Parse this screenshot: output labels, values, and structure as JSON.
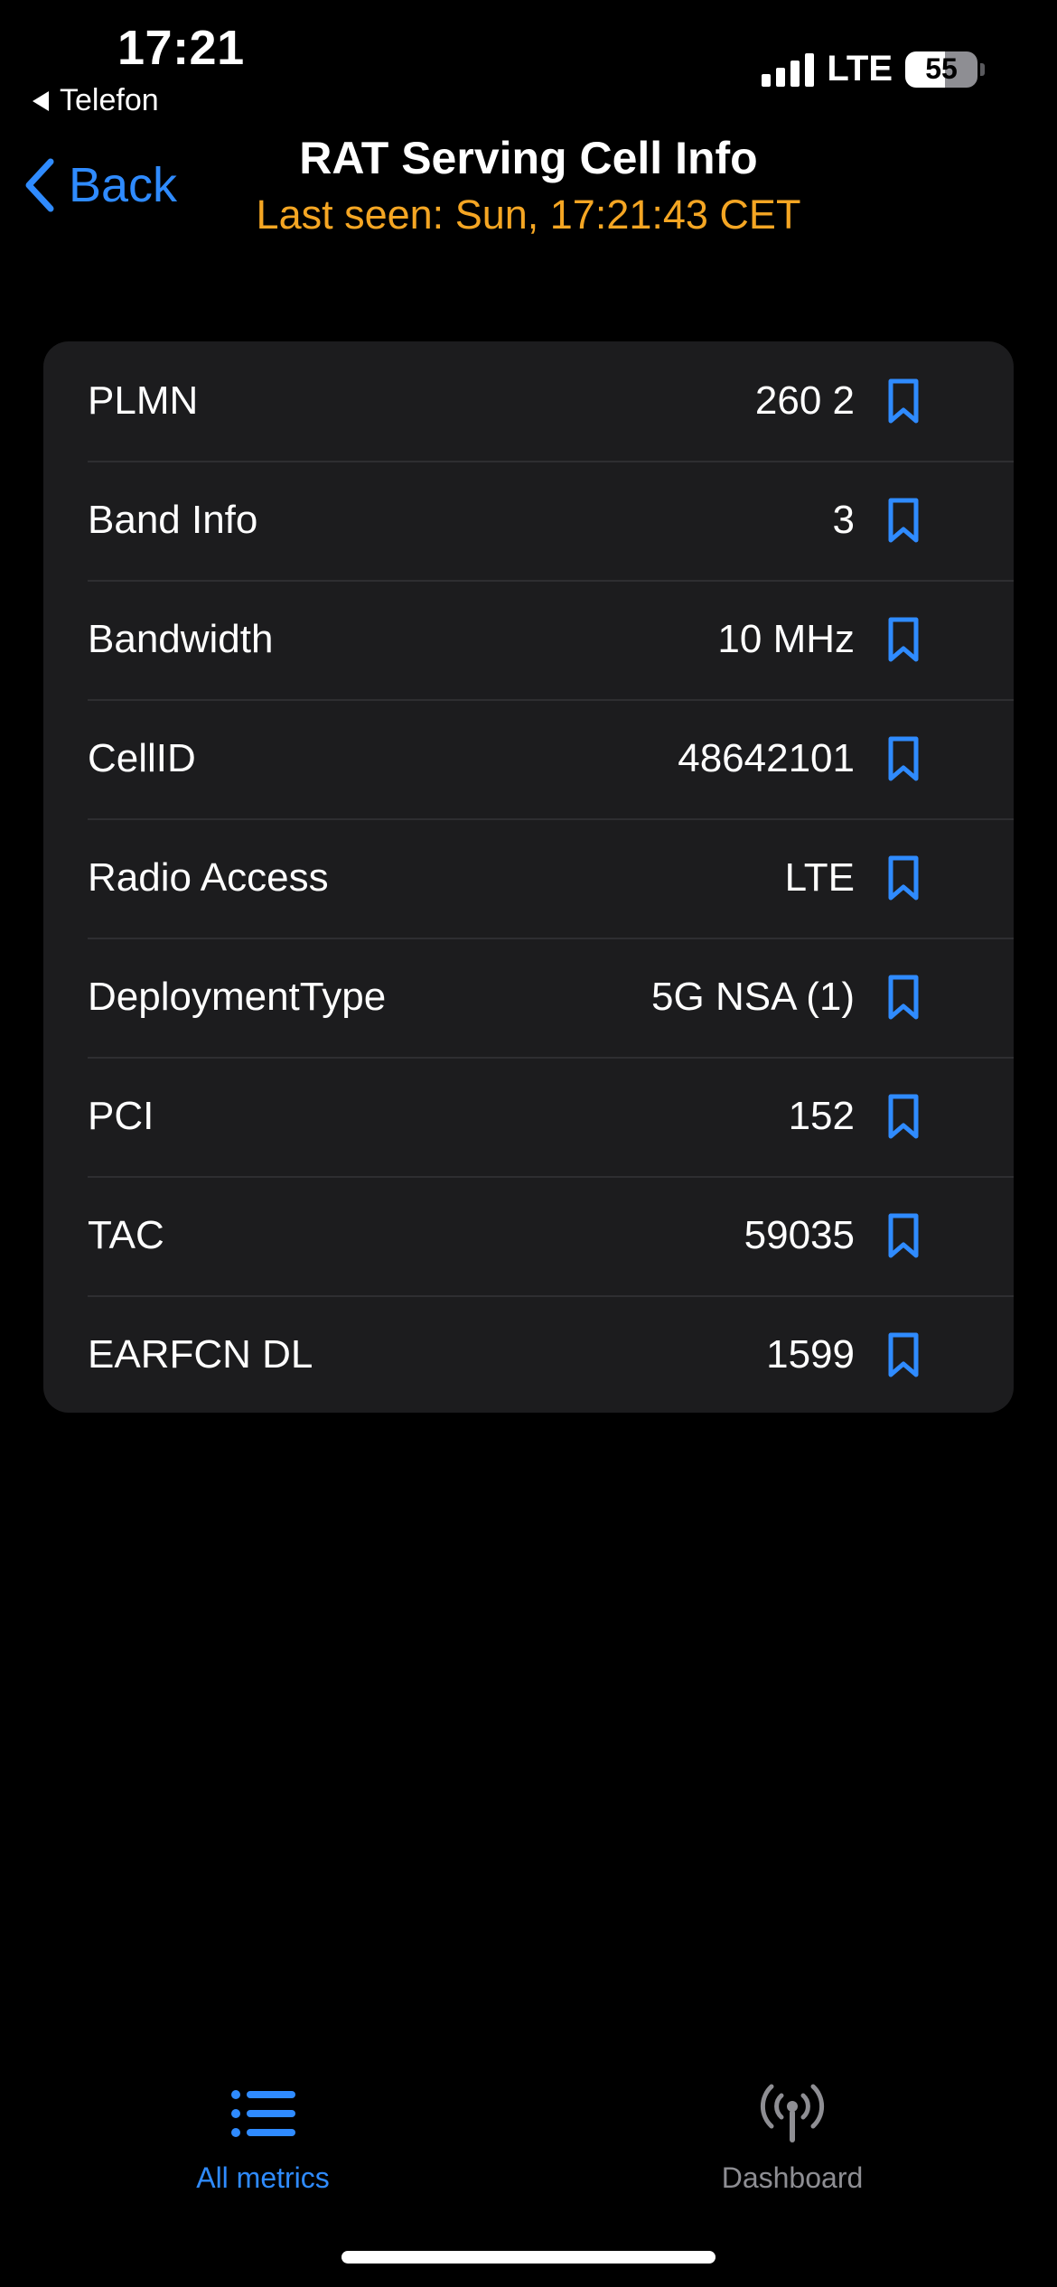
{
  "status_bar": {
    "time": "17:21",
    "back_app": "Telefon",
    "network": "LTE",
    "battery": "55"
  },
  "nav": {
    "back_label": "Back",
    "title": "RAT Serving Cell Info",
    "subtitle": "Last seen: Sun, 17:21:43 CET"
  },
  "rows": [
    {
      "label": "PLMN",
      "value": "260 2"
    },
    {
      "label": "Band Info",
      "value": "3"
    },
    {
      "label": "Bandwidth",
      "value": "10 MHz"
    },
    {
      "label": "CellID",
      "value": "48642101"
    },
    {
      "label": "Radio Access",
      "value": "LTE"
    },
    {
      "label": "DeploymentType",
      "value": "5G NSA (1)"
    },
    {
      "label": "PCI",
      "value": "152"
    },
    {
      "label": "TAC",
      "value": "59035"
    },
    {
      "label": "EARFCN DL",
      "value": "1599"
    }
  ],
  "tabs": {
    "all_metrics": {
      "label": "All metrics",
      "icon": "list-icon",
      "active": true
    },
    "dashboard": {
      "label": "Dashboard",
      "icon": "antenna-icon",
      "active": false
    }
  },
  "colors": {
    "accent": "#2f8bff",
    "subtitle": "#f5a623",
    "card": "#1c1c1e",
    "background": "#000000"
  }
}
